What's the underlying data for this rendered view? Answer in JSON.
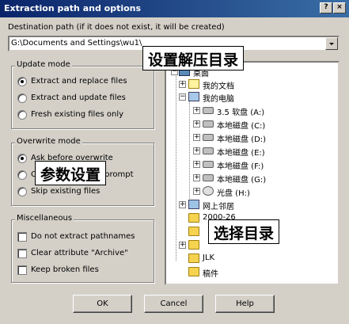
{
  "window": {
    "title": "Extraction path and options",
    "help_label": "?",
    "close_label": "×"
  },
  "path": {
    "label": "Destination path (if it does not exist, it will be created)",
    "value": "G:\\Documents and Settings\\wu1\\"
  },
  "update_mode": {
    "legend": "Update mode",
    "options": [
      {
        "label": "Extract and replace files",
        "selected": true
      },
      {
        "label": "Extract and update files",
        "selected": false
      },
      {
        "label": "Fresh existing files only",
        "selected": false
      }
    ]
  },
  "overwrite_mode": {
    "legend": "Overwrite mode",
    "options": [
      {
        "label": "Ask before overwrite",
        "selected": true
      },
      {
        "label": "Overwrite without prompt",
        "selected": false
      },
      {
        "label": "Skip existing files",
        "selected": false
      }
    ]
  },
  "misc": {
    "legend": "Miscellaneous",
    "options": [
      {
        "label": "Do not extract pathnames",
        "checked": false
      },
      {
        "label": "Clear attribute \"Archive\"",
        "checked": false
      },
      {
        "label": "Keep broken files",
        "checked": false
      }
    ]
  },
  "tree": {
    "items": [
      {
        "label": "桌面",
        "icon": "desktop-icon"
      },
      {
        "label": "我的文档",
        "icon": "my-documents-icon"
      },
      {
        "label": "我的电脑",
        "icon": "my-computer-icon"
      },
      {
        "label": "3.5 软盘 (A:)",
        "icon": "floppy-drive-icon"
      },
      {
        "label": "本地磁盘 (C:)",
        "icon": "disk-drive-icon"
      },
      {
        "label": "本地磁盘 (D:)",
        "icon": "disk-drive-icon"
      },
      {
        "label": "本地磁盘 (E:)",
        "icon": "disk-drive-icon"
      },
      {
        "label": "本地磁盘 (F:)",
        "icon": "disk-drive-icon"
      },
      {
        "label": "本地磁盘 (G:)",
        "icon": "disk-drive-icon"
      },
      {
        "label": "光盘 (H:)",
        "icon": "cd-drive-icon"
      },
      {
        "label": "网上邻居",
        "icon": "network-icon"
      },
      {
        "label": "2000-26",
        "icon": "folder-icon"
      },
      {
        "label": "",
        "icon": "folder-icon"
      },
      {
        "label": "",
        "icon": "folder-icon"
      },
      {
        "label": "JLK",
        "icon": "folder-icon"
      },
      {
        "label": "稿件",
        "icon": "folder-icon"
      }
    ]
  },
  "annotations": {
    "path_note": "设置解压目录",
    "params_note": "参数设置",
    "tree_note": "选择目录"
  },
  "buttons": {
    "ok": "OK",
    "cancel": "Cancel",
    "help": "Help"
  }
}
